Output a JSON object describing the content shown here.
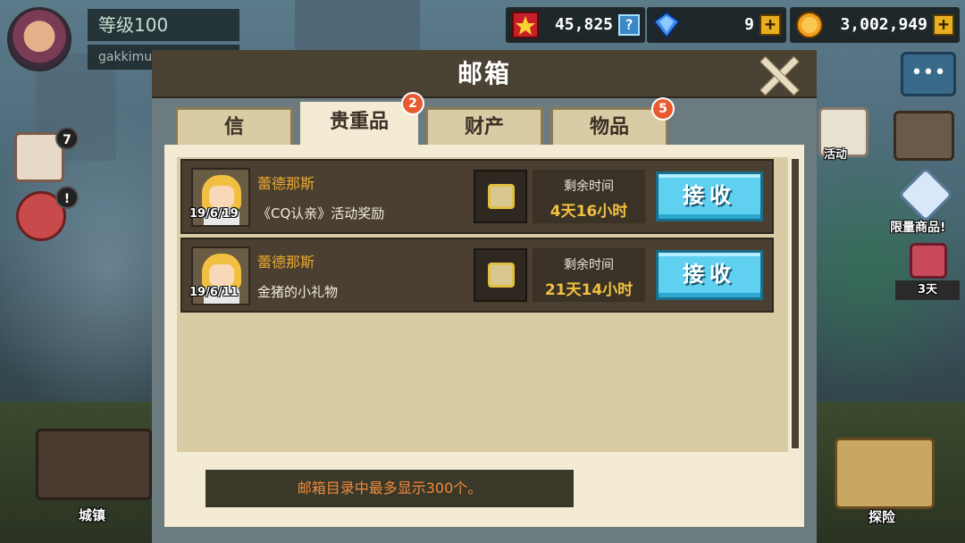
{
  "hud": {
    "level": "等级100",
    "username": "gakkimua",
    "arena_points": "45,825",
    "gems": "9",
    "gold": "3,002,949"
  },
  "side": {
    "left_badge_1": "7",
    "left_badge_2": "!",
    "event_label": "活动",
    "limited_label": "限量商品!",
    "gift_days": "3天",
    "town_label": "城镇",
    "explore_label": "探险"
  },
  "mailbox": {
    "title": "邮箱",
    "tabs": [
      {
        "label": "信",
        "badge": ""
      },
      {
        "label": "贵重品",
        "badge": "2"
      },
      {
        "label": "财产",
        "badge": ""
      },
      {
        "label": "物品",
        "badge": "5"
      }
    ],
    "active_tab": 1,
    "mails": [
      {
        "sender": "蕾德那斯",
        "subject": "《CQ认亲》活动奖励",
        "date": "19/6/19",
        "time_label": "剩余时间",
        "time_value": "4天16小时",
        "button": "接收"
      },
      {
        "sender": "蕾德那斯",
        "subject": "金猪的小礼物",
        "date": "19/6/11",
        "time_label": "剩余时间",
        "time_value": "21天14小时",
        "button": "接收"
      }
    ],
    "footer_note": "邮箱目录中最多显示300个。"
  },
  "colors": {
    "accent_button": "#5fd0f0",
    "sender_text": "#e8a830",
    "time_value": "#f0c040",
    "badge": "#e85a30"
  }
}
